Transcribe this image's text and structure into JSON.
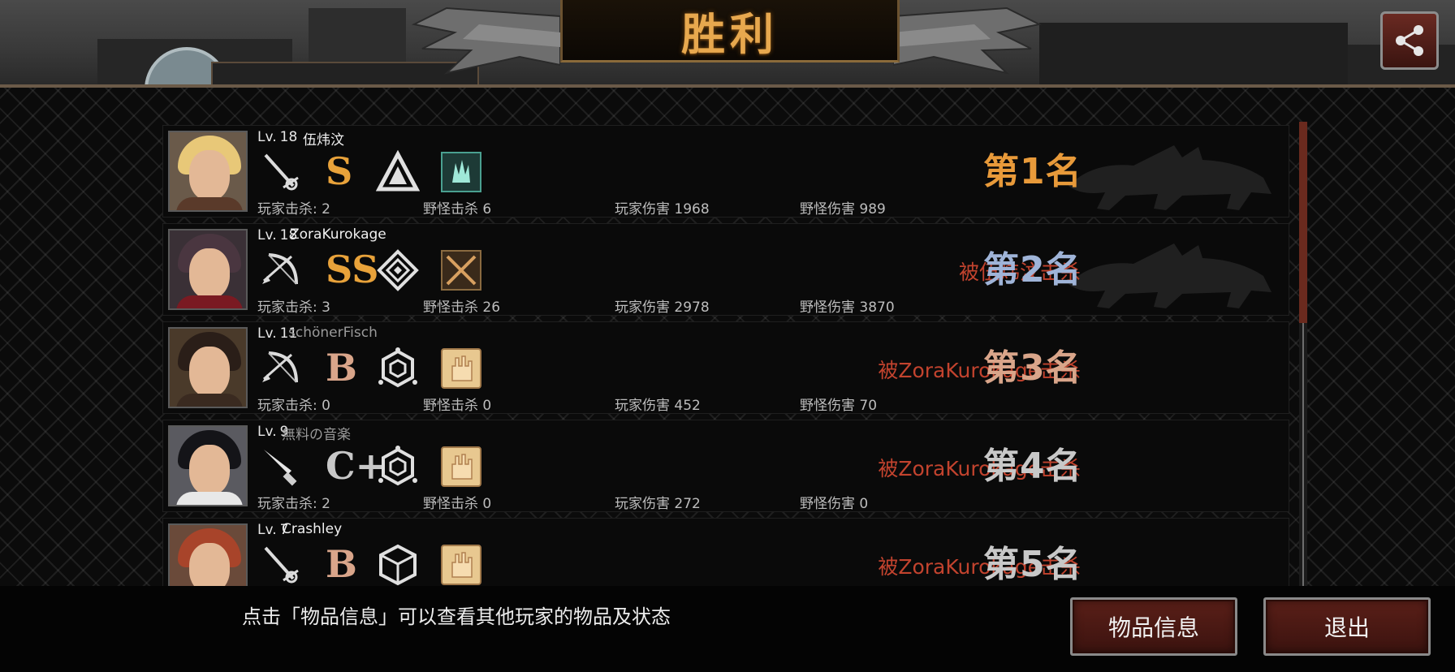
{
  "title": "胜利",
  "players": [
    {
      "level_label": "Lv.",
      "level": "18",
      "name": "伍炜汶",
      "name_dim": false,
      "weapon_icon": "rapier-icon",
      "grade": "S",
      "grade_color": "#e8a23a",
      "skill_icon": "triangle-crest-icon",
      "item_icon": "glove-item-icon",
      "stats": {
        "player_kills": "玩家击杀: 2",
        "monster_kills": "野怪击杀 6",
        "player_damage": "玩家伤害 1968",
        "monster_damage": "野怪伤害 989"
      },
      "killed_by": "",
      "rank": "第1名",
      "rank_color": "#e89a3a"
    },
    {
      "level_label": "Lv.",
      "level": "18",
      "name": "ZoraKurokage",
      "name_dim": false,
      "weapon_icon": "bow-icon",
      "grade": "SS",
      "grade_color": "#e8a23a",
      "skill_icon": "diamond-crest-icon",
      "item_icon": "crossed-blades-item-icon",
      "stats": {
        "player_kills": "玩家击杀: 3",
        "monster_kills": "野怪击杀 26",
        "player_damage": "玩家伤害 2978",
        "monster_damage": "野怪伤害 3870"
      },
      "killed_by": "被伍炜汶击杀",
      "rank": "第2名",
      "rank_color": "#9fb4d8"
    },
    {
      "level_label": "Lv.",
      "level": "11",
      "name": "schönerFisch",
      "name_dim": true,
      "weapon_icon": "bow-icon",
      "grade": "B",
      "grade_color": "#d9a58a",
      "skill_icon": "hexagon-crest-icon",
      "item_icon": "hand-item-icon",
      "stats": {
        "player_kills": "玩家击杀: 0",
        "monster_kills": "野怪击杀 0",
        "player_damage": "玩家伤害 452",
        "monster_damage": "野怪伤害 70"
      },
      "killed_by": "被ZoraKurokage击杀",
      "rank": "第3名",
      "rank_color": "#d9a58a"
    },
    {
      "level_label": "Lv.",
      "level": "9",
      "name": "無料の音楽",
      "name_dim": true,
      "weapon_icon": "knife-icon",
      "grade": "C+",
      "grade_color": "#c8c8c8",
      "skill_icon": "hexagon-crest-icon",
      "item_icon": "hand-item-icon",
      "stats": {
        "player_kills": "玩家击杀: 2",
        "monster_kills": "野怪击杀 0",
        "player_damage": "玩家伤害 272",
        "monster_damage": "野怪伤害 0"
      },
      "killed_by": "被ZoraKurokage击杀",
      "rank": "第4名",
      "rank_color": "#c8c8c8"
    },
    {
      "level_label": "Lv.",
      "level": "7",
      "name": "Crashley",
      "name_dim": false,
      "weapon_icon": "rapier-icon",
      "grade": "B",
      "grade_color": "#d9a58a",
      "skill_icon": "cube-crest-icon",
      "item_icon": "hand-item-icon",
      "stats": {
        "player_kills": "",
        "monster_kills": "",
        "player_damage": "",
        "monster_damage": ""
      },
      "killed_by": "被ZoraKurokage击杀",
      "rank": "第5名",
      "rank_color": "#c8c8c8"
    }
  ],
  "footer": {
    "hint": "点击「物品信息」可以查看其他玩家的物品及状态",
    "items_button": "物品信息",
    "exit_button": "退出"
  },
  "colors": {
    "accent_gold": "#e7a84e",
    "killed_red": "#c2432e",
    "button_red": "#5a1f18"
  }
}
